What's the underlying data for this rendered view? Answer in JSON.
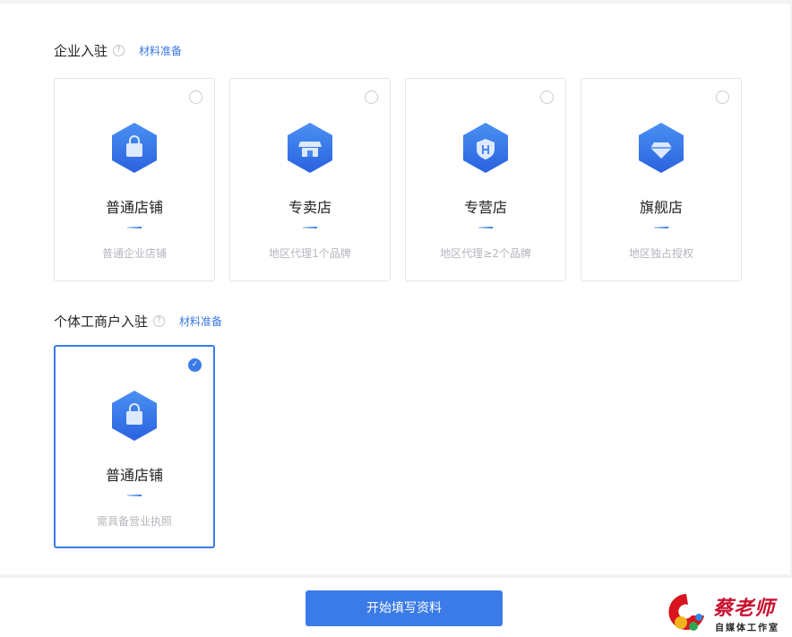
{
  "enterprise": {
    "title": "企业入驻",
    "help": "?",
    "material_link": "材料准备",
    "cards": [
      {
        "name": "普通店铺",
        "desc": "普通企业店铺",
        "icon": "shopping-bag-icon",
        "selected": false
      },
      {
        "name": "专卖店",
        "desc": "地区代理1个品牌",
        "icon": "storefront-icon",
        "selected": false
      },
      {
        "name": "专营店",
        "desc": "地区代理≥2个品牌",
        "icon": "shield-icon",
        "selected": false
      },
      {
        "name": "旗舰店",
        "desc": "地区独占授权",
        "icon": "diamond-icon",
        "selected": false
      }
    ]
  },
  "individual": {
    "title": "个体工商户入驻",
    "help": "?",
    "material_link": "材料准备",
    "cards": [
      {
        "name": "普通店铺",
        "desc": "需具备营业执照",
        "icon": "shopping-bag-icon",
        "selected": true,
        "check": "✓"
      }
    ]
  },
  "footer": {
    "start_button": "开始填写资料"
  },
  "watermark": {
    "title": "蔡老师",
    "subtitle": "自媒体工作室"
  },
  "colors": {
    "accent": "#3a7be8",
    "link": "#3a78e6",
    "hex_top": "#4a90f2",
    "hex_bottom": "#2a62e0"
  }
}
